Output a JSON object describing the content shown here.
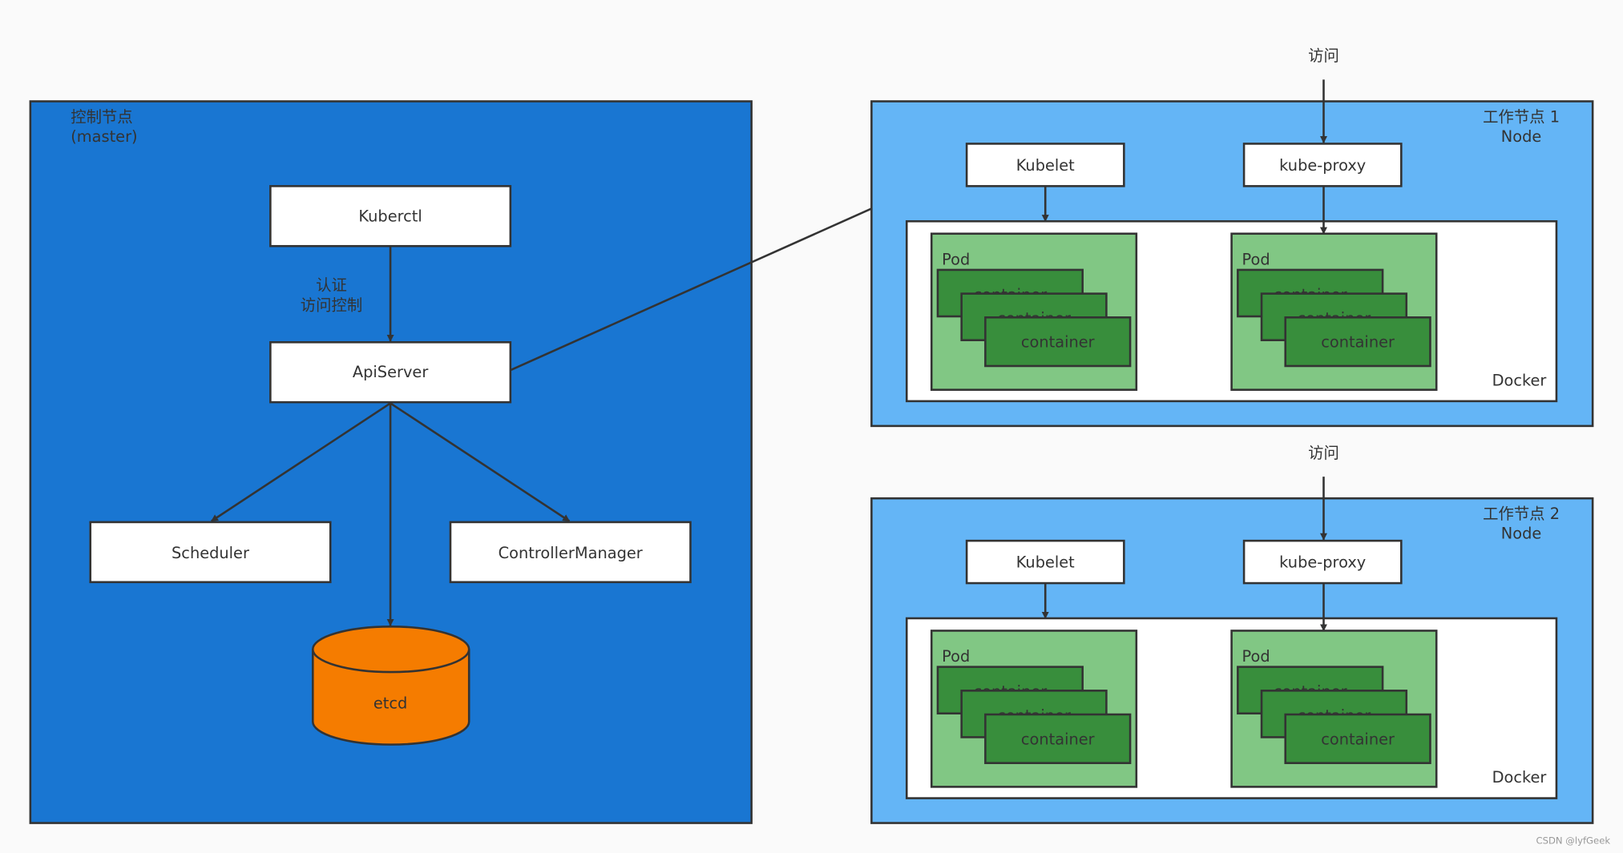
{
  "colors": {
    "master_fill": "#1976d2",
    "worker_fill": "#64b5f6",
    "pod_fill": "#81c784",
    "container_fill": "#388e3c",
    "etcd_fill": "#f57c00",
    "stroke": "#333333"
  },
  "master": {
    "title_line1": "控制节点",
    "title_line2": "(master)",
    "kuberctl": "Kuberctl",
    "auth_line1": "认证",
    "auth_line2": "访问控制",
    "apiserver": "ApiServer",
    "scheduler": "Scheduler",
    "controller_manager": "ControllerManager",
    "etcd": "etcd"
  },
  "workers": [
    {
      "title_line1": "工作节点 1",
      "title_line2": "Node",
      "access_label": "访问",
      "kubelet": "Kubelet",
      "kube_proxy": "kube-proxy",
      "docker": "Docker",
      "pods": [
        {
          "label": "Pod",
          "containers": [
            "container",
            "container",
            "container"
          ]
        },
        {
          "label": "Pod",
          "containers": [
            "container",
            "container",
            "container"
          ]
        }
      ]
    },
    {
      "title_line1": "工作节点 2",
      "title_line2": "Node",
      "access_label": "访问",
      "kubelet": "Kubelet",
      "kube_proxy": "kube-proxy",
      "docker": "Docker",
      "pods": [
        {
          "label": "Pod",
          "containers": [
            "container",
            "container",
            "container"
          ]
        },
        {
          "label": "Pod",
          "containers": [
            "container",
            "container",
            "container"
          ]
        }
      ]
    }
  ],
  "watermark": "CSDN @lyfGeek"
}
